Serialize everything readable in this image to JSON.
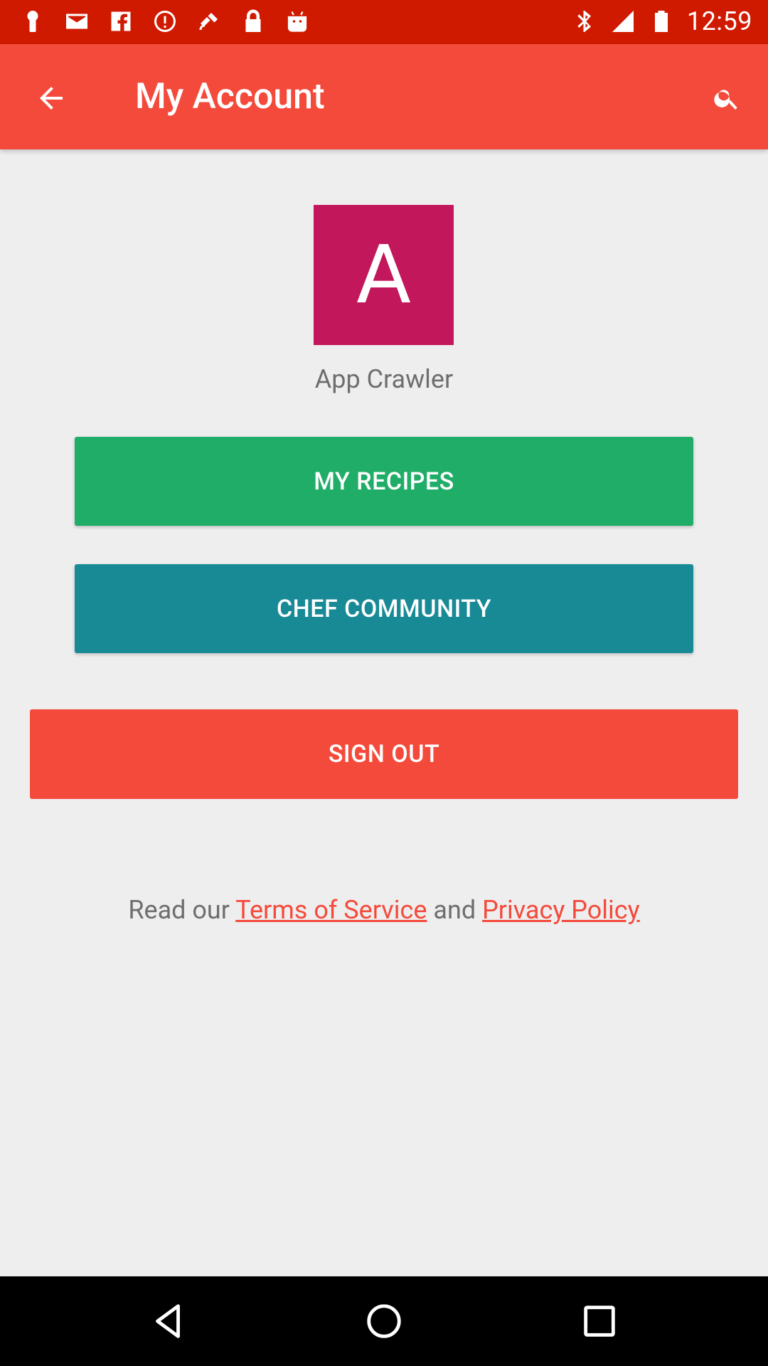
{
  "status_bar": {
    "time": "12:59",
    "left_icons": [
      "keyhole-icon",
      "mail-icon",
      "facebook-icon",
      "no-entry-icon",
      "fake-gps-satellite-icon",
      "lock-icon",
      "android-icon"
    ],
    "right_icons": [
      "bluetooth-icon",
      "signal-icon",
      "battery-icon"
    ]
  },
  "app_bar": {
    "title": "My Account",
    "back_icon": "arrow-back-icon",
    "search_icon": "search-icon",
    "color": "#f44a3b"
  },
  "profile": {
    "avatar_letter": "A",
    "avatar_color": "#c2185b",
    "name": "App Crawler"
  },
  "buttons": {
    "my_recipes": {
      "label": "MY RECIPES",
      "color": "#20ad68"
    },
    "chef_community": {
      "label": "CHEF COMMUNITY",
      "color": "#188a96"
    },
    "sign_out": {
      "label": "SIGN OUT",
      "color": "#f44a3b"
    }
  },
  "legal": {
    "prefix": "Read our",
    "terms": "Terms of Service",
    "and": "and",
    "privacy": "Privacy Policy"
  },
  "nav_bar": {
    "back_icon": "triangle-back-icon",
    "home_icon": "circle-home-icon",
    "recents_icon": "square-recents-icon"
  }
}
